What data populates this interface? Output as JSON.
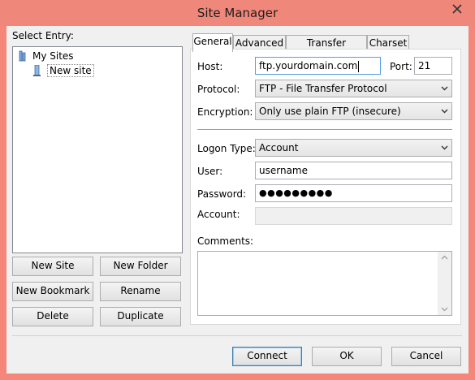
{
  "window": {
    "title": "Site Manager"
  },
  "left": {
    "select_entry_label": "Select Entry:",
    "tree": [
      {
        "label": "My Sites",
        "icon": "folder-icon"
      },
      {
        "label": "New site",
        "icon": "server-icon"
      }
    ],
    "buttons": {
      "new_site": "New Site",
      "new_folder": "New Folder",
      "new_bookmark": "New Bookmark",
      "rename": "Rename",
      "delete": "Delete",
      "duplicate": "Duplicate"
    }
  },
  "tabs": [
    "General",
    "Advanced",
    "Transfer Settings",
    "Charset"
  ],
  "general": {
    "host_label": "Host:",
    "host_value": "ftp.yourdomain.com",
    "port_label": "Port:",
    "port_value": "21",
    "protocol_label": "Protocol:",
    "protocol_value": "FTP - File Transfer Protocol",
    "encryption_label": "Encryption:",
    "encryption_value": "Only use plain FTP (insecure)",
    "logon_type_label": "Logon Type:",
    "logon_type_value": "Account",
    "user_label": "User:",
    "user_value": "username",
    "password_label": "Password:",
    "password_value": "●●●●●●●●●",
    "account_label": "Account:",
    "account_value": "",
    "comments_label": "Comments:"
  },
  "footer": {
    "connect": "Connect",
    "ok": "OK",
    "cancel": "Cancel"
  },
  "colors": {
    "titlebar": "#f0877b",
    "client": "#f0f0f0",
    "focus_border": "#569de5"
  }
}
